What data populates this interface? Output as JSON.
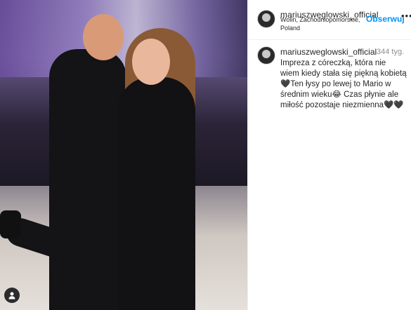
{
  "post": {
    "username": "mariuszweglowski_official",
    "follow_label": "Obserwuj",
    "more_label": "•••",
    "location": "Wolin, Zachodniopomorskie, Poland"
  },
  "comment": {
    "username": "mariuszweglowski_official",
    "time": "344 tyg.",
    "caption": "Impreza z córeczką, która nie wiem kiedy stała się piękną kobietą🖤Ten łysy po lewej to Mario w średnim wieku😂 Czas płynie ale miłość pozostaje niezmienna🖤🖤"
  },
  "icons": {
    "tagged_user": "user-icon"
  },
  "colors": {
    "follow": "#0095f6",
    "text": "#262626",
    "muted": "#8e8e8e"
  }
}
